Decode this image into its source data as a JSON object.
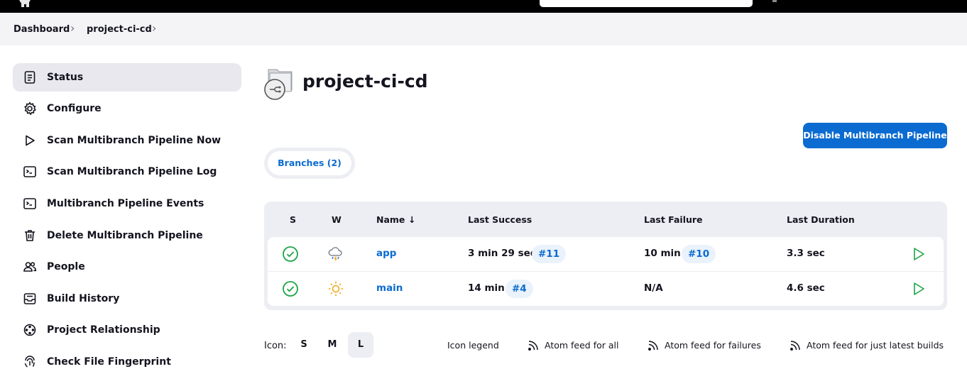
{
  "breadcrumb": {
    "items": [
      "Dashboard",
      "project-ci-cd"
    ]
  },
  "sidebar": {
    "items": [
      {
        "label": "Status",
        "icon": "document-icon",
        "active": true
      },
      {
        "label": "Configure",
        "icon": "gear-icon"
      },
      {
        "label": "Scan Multibranch Pipeline Now",
        "icon": "play-icon"
      },
      {
        "label": "Scan Multibranch Pipeline Log",
        "icon": "terminal-icon"
      },
      {
        "label": "Multibranch Pipeline Events",
        "icon": "terminal-icon"
      },
      {
        "label": "Delete Multibranch Pipeline",
        "icon": "trash-icon"
      },
      {
        "label": "People",
        "icon": "people-icon"
      },
      {
        "label": "Build History",
        "icon": "inbox-icon"
      },
      {
        "label": "Project Relationship",
        "icon": "relationship-icon"
      },
      {
        "label": "Check File Fingerprint",
        "icon": "fingerprint-icon"
      }
    ]
  },
  "main": {
    "title": "project-ci-cd",
    "disable_button": "Disable Multibranch Pipeline",
    "tab": "Branches (2)",
    "table": {
      "headers": {
        "s": "S",
        "w": "W",
        "name": "Name",
        "sort": "↓",
        "last_success": "Last Success",
        "last_failure": "Last Failure",
        "last_duration": "Last Duration"
      },
      "rows": [
        {
          "status": "success",
          "weather": "rain-icon",
          "name": "app",
          "success_time": "3 min 29 sec",
          "success_build": "#11",
          "failure_time": "10 min",
          "failure_build": "#10",
          "duration": "3.3 sec"
        },
        {
          "status": "success",
          "weather": "sun-icon",
          "name": "main",
          "success_time": "14 min",
          "success_build": "#4",
          "failure_time": "N/A",
          "failure_build": "",
          "duration": "4.6 sec"
        }
      ]
    }
  },
  "footer": {
    "icon_label": "Icon:",
    "sizes": [
      "S",
      "M",
      "L"
    ],
    "selected_size": "L",
    "legend": "Icon legend",
    "feed_all": "Atom feed for all",
    "feed_failures": "Atom feed for failures",
    "feed_latest": "Atom feed for just latest builds"
  },
  "colors": {
    "accent": "#0b6bd0",
    "success": "#1ea446",
    "sun": "#f2a91f"
  }
}
